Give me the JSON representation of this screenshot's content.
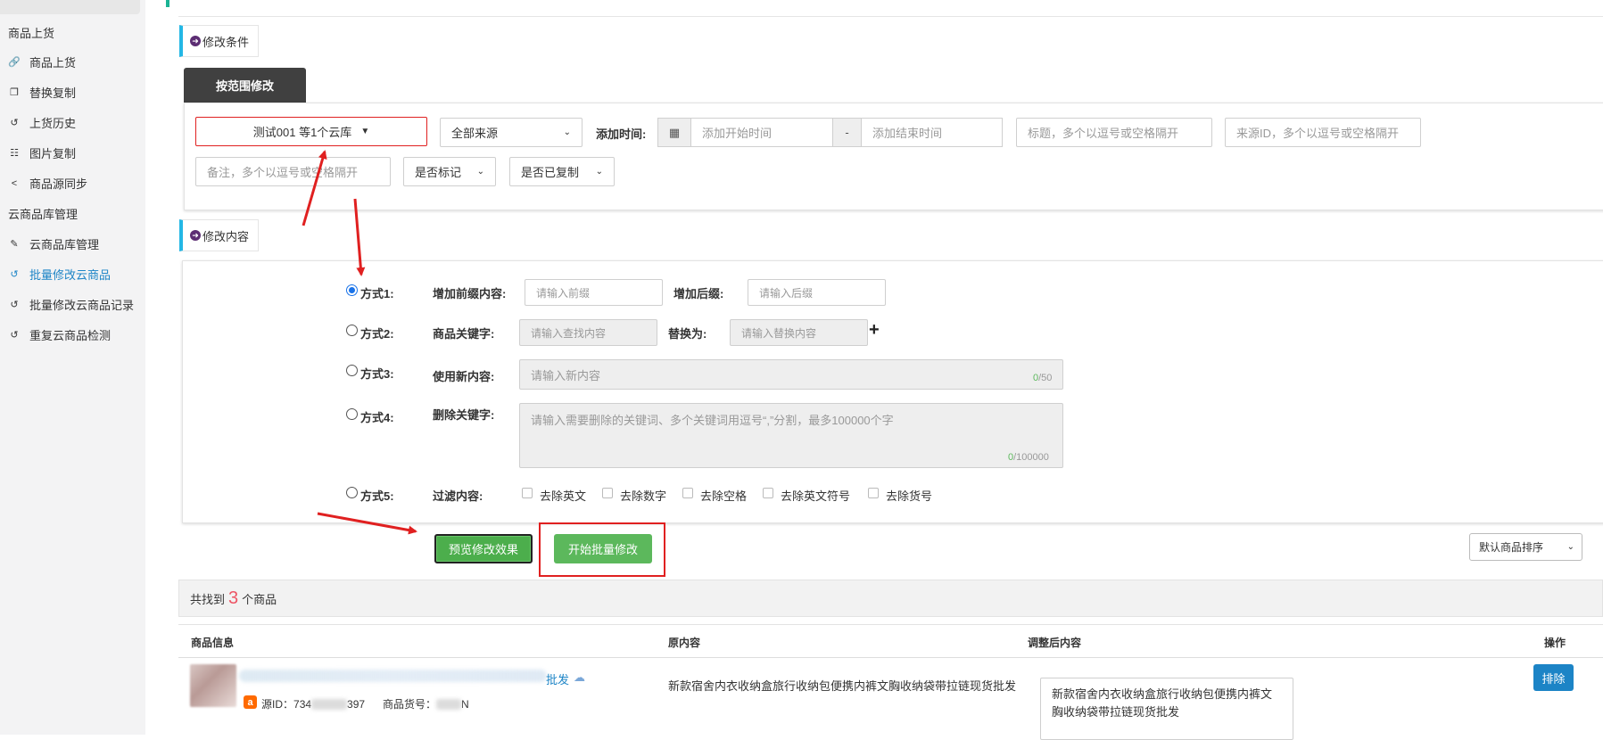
{
  "sidebar": {
    "groups": [
      {
        "label": "商品上货"
      },
      {
        "label": "云商品库管理"
      }
    ],
    "items": [
      {
        "label": "商品上货",
        "icon": "link-icon"
      },
      {
        "label": "替换复制",
        "icon": "copy-icon"
      },
      {
        "label": "上货历史",
        "icon": "history-icon"
      },
      {
        "label": "图片复制",
        "icon": "sitemap-icon"
      },
      {
        "label": "商品源同步",
        "icon": "share-icon"
      },
      {
        "label": "云商品库管理",
        "icon": "edit-icon"
      },
      {
        "label": "批量修改云商品",
        "icon": "history-icon",
        "active": true
      },
      {
        "label": "批量修改云商品记录",
        "icon": "history-icon"
      },
      {
        "label": "重复云商品检测",
        "icon": "history-icon"
      }
    ]
  },
  "conditions": {
    "section_label": "修改条件",
    "tab_label": "按范围修改",
    "cloud_select": "测试001 等1个云库",
    "source_select": "全部来源",
    "add_time_label": "添加时间:",
    "start_placeholder": "添加开始时间",
    "range_sep": "-",
    "end_placeholder": "添加结束时间",
    "title_placeholder": "标题，多个以逗号或空格隔开",
    "source_id_placeholder": "来源ID，多个以逗号或空格隔开",
    "remark_placeholder": "备注，多个以逗号或空格隔开",
    "marked_select": "是否标记",
    "copied_select": "是否已复制"
  },
  "content": {
    "section_label": "修改内容",
    "mode1": {
      "label": "方式1:",
      "prefix_label": "增加前缀内容:",
      "prefix_placeholder": "请输入前缀",
      "suffix_label": "增加后缀:",
      "suffix_placeholder": "请输入后缀",
      "checked": true
    },
    "mode2": {
      "label": "方式2:",
      "keyword_label": "商品关键字:",
      "keyword_placeholder": "请输入查找内容",
      "replace_label": "替换为:",
      "replace_placeholder": "请输入替换内容",
      "plus": "+"
    },
    "mode3": {
      "label": "方式3:",
      "new_label": "使用新内容:",
      "new_placeholder": "请输入新内容",
      "count": "0",
      "max": "/50"
    },
    "mode4": {
      "label": "方式4:",
      "delete_label": "删除关键字:",
      "delete_placeholder": "请输入需要删除的关键词、多个关键词用逗号“,”分割，最多100000个字",
      "count": "0",
      "max": "/100000"
    },
    "mode5": {
      "label": "方式5:",
      "filter_label": "过滤内容:",
      "options": [
        "去除英文",
        "去除数字",
        "去除空格",
        "去除英文符号",
        "去除货号"
      ]
    }
  },
  "actions": {
    "preview": "预览修改效果",
    "start": "开始批量修改",
    "sort": "默认商品排序"
  },
  "result": {
    "prefix": "共找到",
    "count": "3",
    "suffix": "个商品"
  },
  "table": {
    "headers": [
      "商品信息",
      "原内容",
      "调整后内容",
      "操作"
    ],
    "rows": [
      {
        "title_tail": "批发",
        "source_id_label": "源ID：",
        "source_id_a": "734",
        "source_id_b": "397",
        "sku_label": "商品货号：",
        "sku_tail": "N",
        "original": "新款宿舍内衣收纳盒旅行收纳包便携内裤文胸收纳袋带拉链现货批发",
        "adjusted": "新款宿舍内衣收纳盒旅行收纳包便携内裤文胸收纳袋带拉链现货批发",
        "action": "排除"
      }
    ]
  },
  "colors": {
    "accent_blue": "#1c84c6",
    "green": "#5cb85c",
    "highlight_red": "#e02020",
    "count_red": "#ed5565"
  }
}
